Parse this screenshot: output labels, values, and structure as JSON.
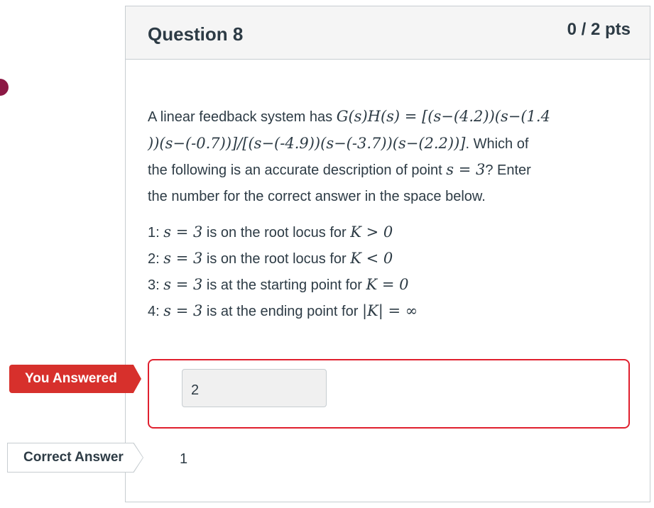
{
  "question": {
    "title": "Question 8",
    "points": "0 / 2 pts",
    "intro": "A linear feedback system has ",
    "gh_expr": "G(s)H(s) = [(s−(4.2))(s−(1.4",
    "gh_expr2": "))(s−(-0.7))]/[(s−(-4.9))(s−(-3.7))(s−(2.2))]",
    "after_expr": ". Which of",
    "line3_a": "the following is an accurate description of point ",
    "line3_math": "s = 3",
    "line3_b": "? Enter",
    "line4": "the number for the correct answer in the space below."
  },
  "options": [
    {
      "num": "1: ",
      "math": "s = 3",
      "text": " is on the root locus for ",
      "cond": "K > 0"
    },
    {
      "num": "2: ",
      "math": "s = 3",
      "text": " is on the root locus for ",
      "cond": "K < 0"
    },
    {
      "num": "3: ",
      "math": "s = 3",
      "text": " is at the starting point for ",
      "cond": "K = 0"
    },
    {
      "num": "4: ",
      "math": "s = 3",
      "text": " is at the ending point for ",
      "cond": "|K| = ∞"
    }
  ],
  "answers": {
    "you_answered_label": "You Answered",
    "you_answered_value": "2",
    "correct_label": "Correct Answer",
    "correct_value": "1"
  },
  "colors": {
    "incorrect": "#d7302c",
    "accent_dot": "#8c1844"
  }
}
